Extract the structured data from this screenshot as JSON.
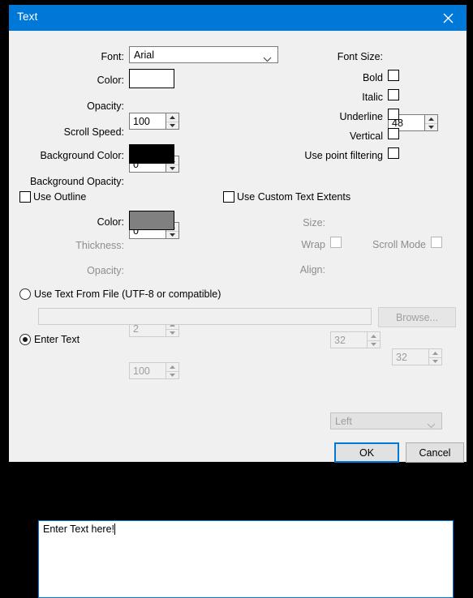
{
  "window": {
    "title": "Text",
    "close_icon": "close-icon"
  },
  "left_column": {
    "font": {
      "label": "Font:",
      "value": "Arial",
      "options": [
        "Arial"
      ]
    },
    "color": {
      "label": "Color:",
      "value": "#ffffff"
    },
    "opacity": {
      "label": "Opacity:",
      "value": "100"
    },
    "scroll_speed": {
      "label": "Scroll Speed:",
      "value": "0"
    },
    "background_color": {
      "label": "Background Color:",
      "value": "#000000"
    },
    "background_opacity": {
      "label": "Background Opacity:",
      "value": "0"
    }
  },
  "right_column": {
    "font_size": {
      "label": "Font Size:",
      "value": "48"
    },
    "checkboxes": [
      {
        "label": "Bold",
        "checked": false
      },
      {
        "label": "Italic",
        "checked": false
      },
      {
        "label": "Underline",
        "checked": false
      },
      {
        "label": "Vertical",
        "checked": false
      },
      {
        "label": "Use point filtering",
        "checked": false
      }
    ]
  },
  "outline_group": {
    "use_outline": {
      "label": "Use Outline",
      "checked": false
    },
    "color": {
      "label": "Color:",
      "value": "#808080"
    },
    "thickness": {
      "label": "Thickness:",
      "value": "2",
      "enabled": false
    },
    "opacity": {
      "label": "Opacity:",
      "value": "100",
      "enabled": false
    }
  },
  "extents_group": {
    "use_custom": {
      "label": "Use Custom Text Extents",
      "checked": false
    },
    "size": {
      "label": "Size:",
      "width": "32",
      "height": "32",
      "enabled": false
    },
    "wrap": {
      "label": "Wrap",
      "checked": false,
      "enabled": false
    },
    "scroll_mode": {
      "label": "Scroll Mode",
      "checked": false,
      "enabled": false
    },
    "align": {
      "label": "Align:",
      "value": "Left",
      "enabled": false
    }
  },
  "source_group": {
    "use_file": {
      "label": "Use Text From File (UTF-8 or compatible)",
      "selected": false
    },
    "file_path": {
      "value": "",
      "enabled": false
    },
    "browse_button": {
      "label": "Browse...",
      "enabled": false
    },
    "enter_text": {
      "label": "Enter Text",
      "selected": true
    },
    "text_value": "Enter Text here!"
  },
  "footer": {
    "ok_label": "OK",
    "cancel_label": "Cancel"
  },
  "colors": {
    "accent": "#0078d7",
    "dialog_bg": "#f0f0f0",
    "frame": "#000000"
  }
}
